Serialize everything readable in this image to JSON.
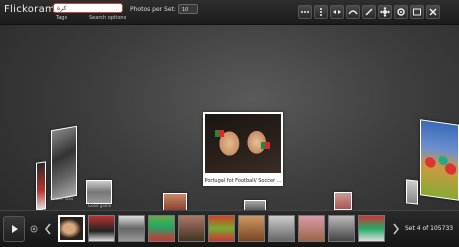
{
  "app": {
    "title": "Flickorama"
  },
  "search": {
    "value": "كرة",
    "tags_label": "Tags",
    "options_label": "Search options"
  },
  "photos_per_set": {
    "label": "Photos per Set:",
    "value": "10"
  },
  "toolbar": {
    "icons": [
      "more-icon",
      "menu-icon",
      "spread-icon",
      "arch-icon",
      "wand-icon",
      "flower-icon",
      "gear-icon",
      "fullscreen-icon",
      "close-icon"
    ]
  },
  "stage": {
    "main_caption": "Portugal fot Football/ Soccer ...",
    "left_caption": "Soccer fans",
    "center_left_caption": "Good game"
  },
  "filmstrip": {
    "set_label": "Set 4 of 105733",
    "thumb_count": 11,
    "selected_index": 0
  },
  "colors": {
    "accent_red": "#cc4444",
    "background": "#3d3d3d"
  }
}
